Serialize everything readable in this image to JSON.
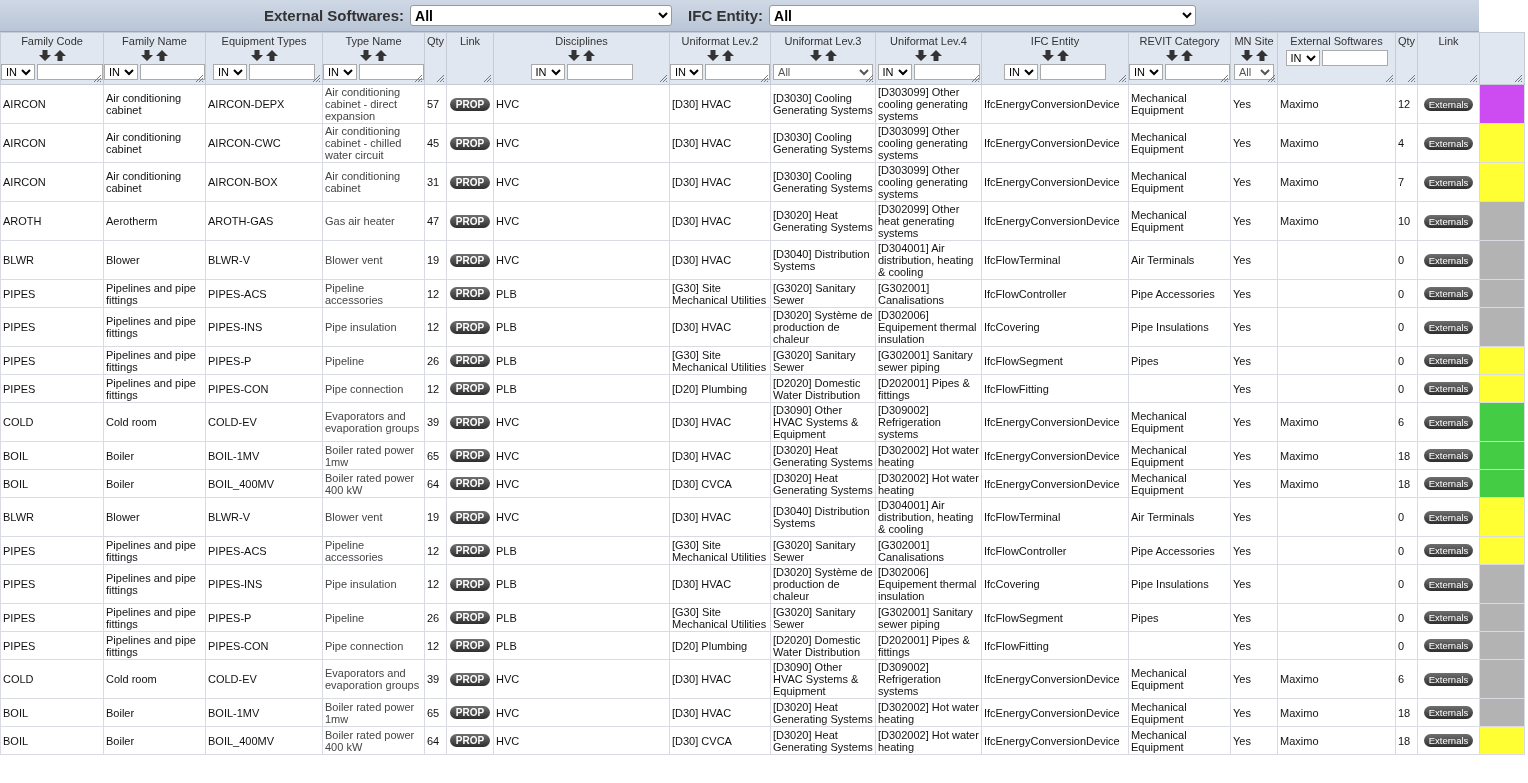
{
  "top_filters": [
    {
      "label": "External Softwares:",
      "value": "All"
    },
    {
      "label": "IFC Entity:",
      "value": "All"
    }
  ],
  "columns": [
    {
      "label": "Family Code",
      "sortable": true,
      "filter": {
        "kind": "operator",
        "operator": "IN"
      }
    },
    {
      "label": "Family Name",
      "sortable": true,
      "filter": {
        "kind": "operator",
        "operator": "IN"
      }
    },
    {
      "label": "Equipment Types",
      "sortable": true,
      "filter": {
        "kind": "operator",
        "operator": "IN"
      }
    },
    {
      "label": "Type Name",
      "sortable": true,
      "filter": {
        "kind": "operator",
        "operator": "IN"
      }
    },
    {
      "label": "Qty",
      "sortable": false
    },
    {
      "label": "Link",
      "sortable": false
    },
    {
      "label": "Disciplines",
      "sortable": true,
      "filter": {
        "kind": "operator",
        "operator": "IN"
      }
    },
    {
      "label": "Uniformat Lev.2",
      "sortable": true,
      "filter": {
        "kind": "operator",
        "operator": "IN"
      }
    },
    {
      "label": "Uniformat Lev.3",
      "sortable": true,
      "filter": {
        "kind": "choice",
        "value": "All"
      }
    },
    {
      "label": "Uniformat Lev.4",
      "sortable": true,
      "filter": {
        "kind": "operator",
        "operator": "IN"
      }
    },
    {
      "label": "IFC Entity",
      "sortable": true,
      "filter": {
        "kind": "operator",
        "operator": "IN"
      }
    },
    {
      "label": "REVIT Category",
      "sortable": true,
      "filter": {
        "kind": "operator",
        "operator": "IN"
      }
    },
    {
      "label": "MN Site",
      "sortable": true,
      "filter": {
        "kind": "choice",
        "value": "All"
      }
    },
    {
      "label": "External Softwares",
      "sortable": false,
      "filter": {
        "kind": "operator",
        "operator": "IN"
      }
    },
    {
      "label": "Qty",
      "sortable": false
    },
    {
      "label": "Link",
      "sortable": false
    }
  ],
  "rows": [
    {
      "family_code": "AIRCON",
      "family_name": "Air conditioning cabinet",
      "equipment_type": "AIRCON-DEPX",
      "type_name": "Air conditioning cabinet - direct expansion",
      "qty": "57",
      "link": "PROP",
      "discipline": "HVC",
      "uniformat_2": "[D30] HVAC",
      "uniformat_3": "[D3030] Cooling Generating Systems",
      "uniformat_4": "[D303099] Other cooling generating systems",
      "ifc_entity": "IfcEnergyConversionDevice",
      "revit_category": "Mechanical Equipment",
      "mn_site": "Yes",
      "external_software": "Maximo",
      "qty_2": "12",
      "link_2": "Externals",
      "color": "#cc4cf2"
    },
    {
      "family_code": "AIRCON",
      "family_name": "Air conditioning cabinet",
      "equipment_type": "AIRCON-CWC",
      "type_name": "Air conditioning cabinet - chilled water circuit",
      "qty": "45",
      "link": "PROP",
      "discipline": "HVC",
      "uniformat_2": "[D30] HVAC",
      "uniformat_3": "[D3030] Cooling Generating Systems",
      "uniformat_4": "[D303099] Other cooling generating systems",
      "ifc_entity": "IfcEnergyConversionDevice",
      "revit_category": "Mechanical Equipment",
      "mn_site": "Yes",
      "external_software": "Maximo",
      "qty_2": "4",
      "link_2": "Externals",
      "color": "#ffff33"
    },
    {
      "family_code": "AIRCON",
      "family_name": "Air conditioning cabinet",
      "equipment_type": "AIRCON-BOX",
      "type_name": "Air conditioning cabinet",
      "qty": "31",
      "link": "PROP",
      "discipline": "HVC",
      "uniformat_2": "[D30] HVAC",
      "uniformat_3": "[D3030] Cooling Generating Systems",
      "uniformat_4": "[D303099] Other cooling generating systems",
      "ifc_entity": "IfcEnergyConversionDevice",
      "revit_category": "Mechanical Equipment",
      "mn_site": "Yes",
      "external_software": "Maximo",
      "qty_2": "7",
      "link_2": "Externals",
      "color": "#ffff33"
    },
    {
      "family_code": "AROTH",
      "family_name": "Aerotherm",
      "equipment_type": "AROTH-GAS",
      "type_name": "Gas air heater",
      "qty": "47",
      "link": "PROP",
      "discipline": "HVC",
      "uniformat_2": "[D30] HVAC",
      "uniformat_3": "[D3020] Heat Generating Systems",
      "uniformat_4": "[D302099] Other heat generating systems",
      "ifc_entity": "IfcEnergyConversionDevice",
      "revit_category": "Mechanical Equipment",
      "mn_site": "Yes",
      "external_software": "Maximo",
      "qty_2": "10",
      "link_2": "Externals",
      "color": "#b3b3b3"
    },
    {
      "family_code": "BLWR",
      "family_name": "Blower",
      "equipment_type": "BLWR-V",
      "type_name": "Blower vent",
      "qty": "19",
      "link": "PROP",
      "discipline": "HVC",
      "uniformat_2": "[D30] HVAC",
      "uniformat_3": "[D3040] Distribution Systems",
      "uniformat_4": "[D304001] Air distribution, heating & cooling",
      "ifc_entity": "IfcFlowTerminal",
      "revit_category": "Air Terminals",
      "mn_site": "Yes",
      "qty_2": "0",
      "link_2": "Externals",
      "color": "#b3b3b3"
    },
    {
      "family_code": "PIPES",
      "family_name": "Pipelines and pipe fittings",
      "equipment_type": "PIPES-ACS",
      "type_name": "Pipeline accessories",
      "qty": "12",
      "link": "PROP",
      "discipline": "PLB",
      "uniformat_2": "[G30] Site Mechanical Utilities",
      "uniformat_3": "[G3020] Sanitary Sewer",
      "uniformat_4": "[G302001] Canalisations",
      "ifc_entity": "IfcFlowController",
      "revit_category": "Pipe Accessories",
      "mn_site": "Yes",
      "qty_2": "0",
      "link_2": "Externals",
      "color": "#b3b3b3"
    },
    {
      "family_code": "PIPES",
      "family_name": "Pipelines and pipe fittings",
      "equipment_type": "PIPES-INS",
      "type_name": "Pipe insulation",
      "qty": "12",
      "link": "PROP",
      "discipline": "PLB",
      "uniformat_2": "[D30] HVAC",
      "uniformat_3": "[D3020] Système de production de chaleur",
      "uniformat_4": "[D302006] Equipement thermal insulation",
      "ifc_entity": "IfcCovering",
      "revit_category": "Pipe Insulations",
      "mn_site": "Yes",
      "qty_2": "0",
      "link_2": "Externals",
      "color": "#b3b3b3"
    },
    {
      "family_code": "PIPES",
      "family_name": "Pipelines and pipe fittings",
      "equipment_type": "PIPES-P",
      "type_name": "Pipeline",
      "qty": "26",
      "link": "PROP",
      "discipline": "PLB",
      "uniformat_2": "[G30] Site Mechanical Utilities",
      "uniformat_3": "[G3020] Sanitary Sewer",
      "uniformat_4": "[G302001] Sanitary sewer piping",
      "ifc_entity": "IfcFlowSegment",
      "revit_category": "Pipes",
      "mn_site": "Yes",
      "qty_2": "0",
      "link_2": "Externals",
      "color": "#ffff33"
    },
    {
      "family_code": "PIPES",
      "family_name": "Pipelines and pipe fittings",
      "equipment_type": "PIPES-CON",
      "type_name": "Pipe connection",
      "qty": "12",
      "link": "PROP",
      "discipline": "PLB",
      "uniformat_2": "[D20] Plumbing",
      "uniformat_3": "[D2020] Domestic Water Distribution",
      "uniformat_4": "[D202001] Pipes & fittings",
      "ifc_entity": "IfcFlowFitting",
      "mn_site": "Yes",
      "qty_2": "0",
      "link_2": "Externals",
      "color": "#ffff33"
    },
    {
      "family_code": "COLD",
      "family_name": "Cold room",
      "equipment_type": "COLD-EV",
      "type_name": "Evaporators and evaporation groups",
      "qty": "39",
      "link": "PROP",
      "discipline": "HVC",
      "uniformat_2": "[D30] HVAC",
      "uniformat_3": "[D3090] Other HVAC Systems & Equipment",
      "uniformat_4": "[D309002] Refrigeration systems",
      "ifc_entity": "IfcEnergyConversionDevice",
      "revit_category": "Mechanical Equipment",
      "mn_site": "Yes",
      "external_software": "Maximo",
      "qty_2": "6",
      "link_2": "Externals",
      "color": "#44cc44"
    },
    {
      "family_code": "BOIL",
      "family_name": "Boiler",
      "equipment_type": "BOIL-1MV",
      "type_name": "Boiler rated power 1mw",
      "qty": "65",
      "link": "PROP",
      "discipline": "HVC",
      "uniformat_2": "[D30] HVAC",
      "uniformat_3": "[D3020] Heat Generating Systems",
      "uniformat_4": "[D302002] Hot water heating",
      "ifc_entity": "IfcEnergyConversionDevice",
      "revit_category": "Mechanical Equipment",
      "mn_site": "Yes",
      "external_software": "Maximo",
      "qty_2": "18",
      "link_2": "Externals",
      "color": "#44cc44"
    },
    {
      "family_code": "BOIL",
      "family_name": "Boiler",
      "equipment_type": "BOIL_400MV",
      "type_name": "Boiler rated power 400 kW",
      "qty": "64",
      "link": "PROP",
      "discipline": "HVC",
      "uniformat_2": "[D30] CVCA",
      "uniformat_3": "[D3020] Heat Generating Systems",
      "uniformat_4": "[D302002] Hot water heating",
      "ifc_entity": "IfcEnergyConversionDevice",
      "revit_category": "Mechanical Equipment",
      "mn_site": "Yes",
      "external_software": "Maximo",
      "qty_2": "18",
      "link_2": "Externals",
      "color": "#44cc44"
    },
    {
      "family_code": "BLWR",
      "family_name": "Blower",
      "equipment_type": "BLWR-V",
      "type_name": "Blower vent",
      "qty": "19",
      "link": "PROP",
      "discipline": "HVC",
      "uniformat_2": "[D30] HVAC",
      "uniformat_3": "[D3040] Distribution Systems",
      "uniformat_4": "[D304001] Air distribution, heating & cooling",
      "ifc_entity": "IfcFlowTerminal",
      "revit_category": "Air Terminals",
      "mn_site": "Yes",
      "qty_2": "0",
      "link_2": "Externals",
      "color": "#ffff33"
    },
    {
      "family_code": "PIPES",
      "family_name": "Pipelines and pipe fittings",
      "equipment_type": "PIPES-ACS",
      "type_name": "Pipeline accessories",
      "qty": "12",
      "link": "PROP",
      "discipline": "PLB",
      "uniformat_2": "[G30] Site Mechanical Utilities",
      "uniformat_3": "[G3020] Sanitary Sewer",
      "uniformat_4": "[G302001] Canalisations",
      "ifc_entity": "IfcFlowController",
      "revit_category": "Pipe Accessories",
      "mn_site": "Yes",
      "qty_2": "0",
      "link_2": "Externals",
      "color": "#ffff33"
    },
    {
      "family_code": "PIPES",
      "family_name": "Pipelines and pipe fittings",
      "equipment_type": "PIPES-INS",
      "type_name": "Pipe insulation",
      "qty": "12",
      "link": "PROP",
      "discipline": "PLB",
      "uniformat_2": "[D30] HVAC",
      "uniformat_3": "[D3020] Système de production de chaleur",
      "uniformat_4": "[D302006] Equipement thermal insulation",
      "ifc_entity": "IfcCovering",
      "revit_category": "Pipe Insulations",
      "mn_site": "Yes",
      "qty_2": "0",
      "link_2": "Externals",
      "color": "#b3b3b3"
    },
    {
      "family_code": "PIPES",
      "family_name": "Pipelines and pipe fittings",
      "equipment_type": "PIPES-P",
      "type_name": "Pipeline",
      "qty": "26",
      "link": "PROP",
      "discipline": "PLB",
      "uniformat_2": "[G30] Site Mechanical Utilities",
      "uniformat_3": "[G3020] Sanitary Sewer",
      "uniformat_4": "[G302001] Sanitary sewer piping",
      "ifc_entity": "IfcFlowSegment",
      "revit_category": "Pipes",
      "mn_site": "Yes",
      "qty_2": "0",
      "link_2": "Externals",
      "color": "#b3b3b3"
    },
    {
      "family_code": "PIPES",
      "family_name": "Pipelines and pipe fittings",
      "equipment_type": "PIPES-CON",
      "type_name": "Pipe connection",
      "qty": "12",
      "link": "PROP",
      "discipline": "PLB",
      "uniformat_2": "[D20] Plumbing",
      "uniformat_3": "[D2020] Domestic Water Distribution",
      "uniformat_4": "[D202001] Pipes & fittings",
      "ifc_entity": "IfcFlowFitting",
      "mn_site": "Yes",
      "qty_2": "0",
      "link_2": "Externals",
      "color": "#b3b3b3"
    },
    {
      "family_code": "COLD",
      "family_name": "Cold room",
      "equipment_type": "COLD-EV",
      "type_name": "Evaporators and evaporation groups",
      "qty": "39",
      "link": "PROP",
      "discipline": "HVC",
      "uniformat_2": "[D30] HVAC",
      "uniformat_3": "[D3090] Other HVAC Systems & Equipment",
      "uniformat_4": "[D309002] Refrigeration systems",
      "ifc_entity": "IfcEnergyConversionDevice",
      "revit_category": "Mechanical Equipment",
      "mn_site": "Yes",
      "external_software": "Maximo",
      "qty_2": "6",
      "link_2": "Externals",
      "color": "#b3b3b3"
    },
    {
      "family_code": "BOIL",
      "family_name": "Boiler",
      "equipment_type": "BOIL-1MV",
      "type_name": "Boiler rated power 1mw",
      "qty": "65",
      "link": "PROP",
      "discipline": "HVC",
      "uniformat_2": "[D30] HVAC",
      "uniformat_3": "[D3020] Heat Generating Systems",
      "uniformat_4": "[D302002] Hot water heating",
      "ifc_entity": "IfcEnergyConversionDevice",
      "revit_category": "Mechanical Equipment",
      "mn_site": "Yes",
      "external_software": "Maximo",
      "qty_2": "18",
      "link_2": "Externals",
      "color": "#b3b3b3"
    },
    {
      "family_code": "BOIL",
      "family_name": "Boiler",
      "equipment_type": "BOIL_400MV",
      "type_name": "Boiler rated power 400 kW",
      "qty": "64",
      "link": "PROP",
      "discipline": "HVC",
      "uniformat_2": "[D30] CVCA",
      "uniformat_3": "[D3020] Heat Generating Systems",
      "uniformat_4": "[D302002] Hot water heating",
      "ifc_entity": "IfcEnergyConversionDevice",
      "revit_category": "Mechanical Equipment",
      "mn_site": "Yes",
      "external_software": "Maximo",
      "qty_2": "18",
      "link_2": "Externals",
      "color": "#ffff33"
    }
  ]
}
